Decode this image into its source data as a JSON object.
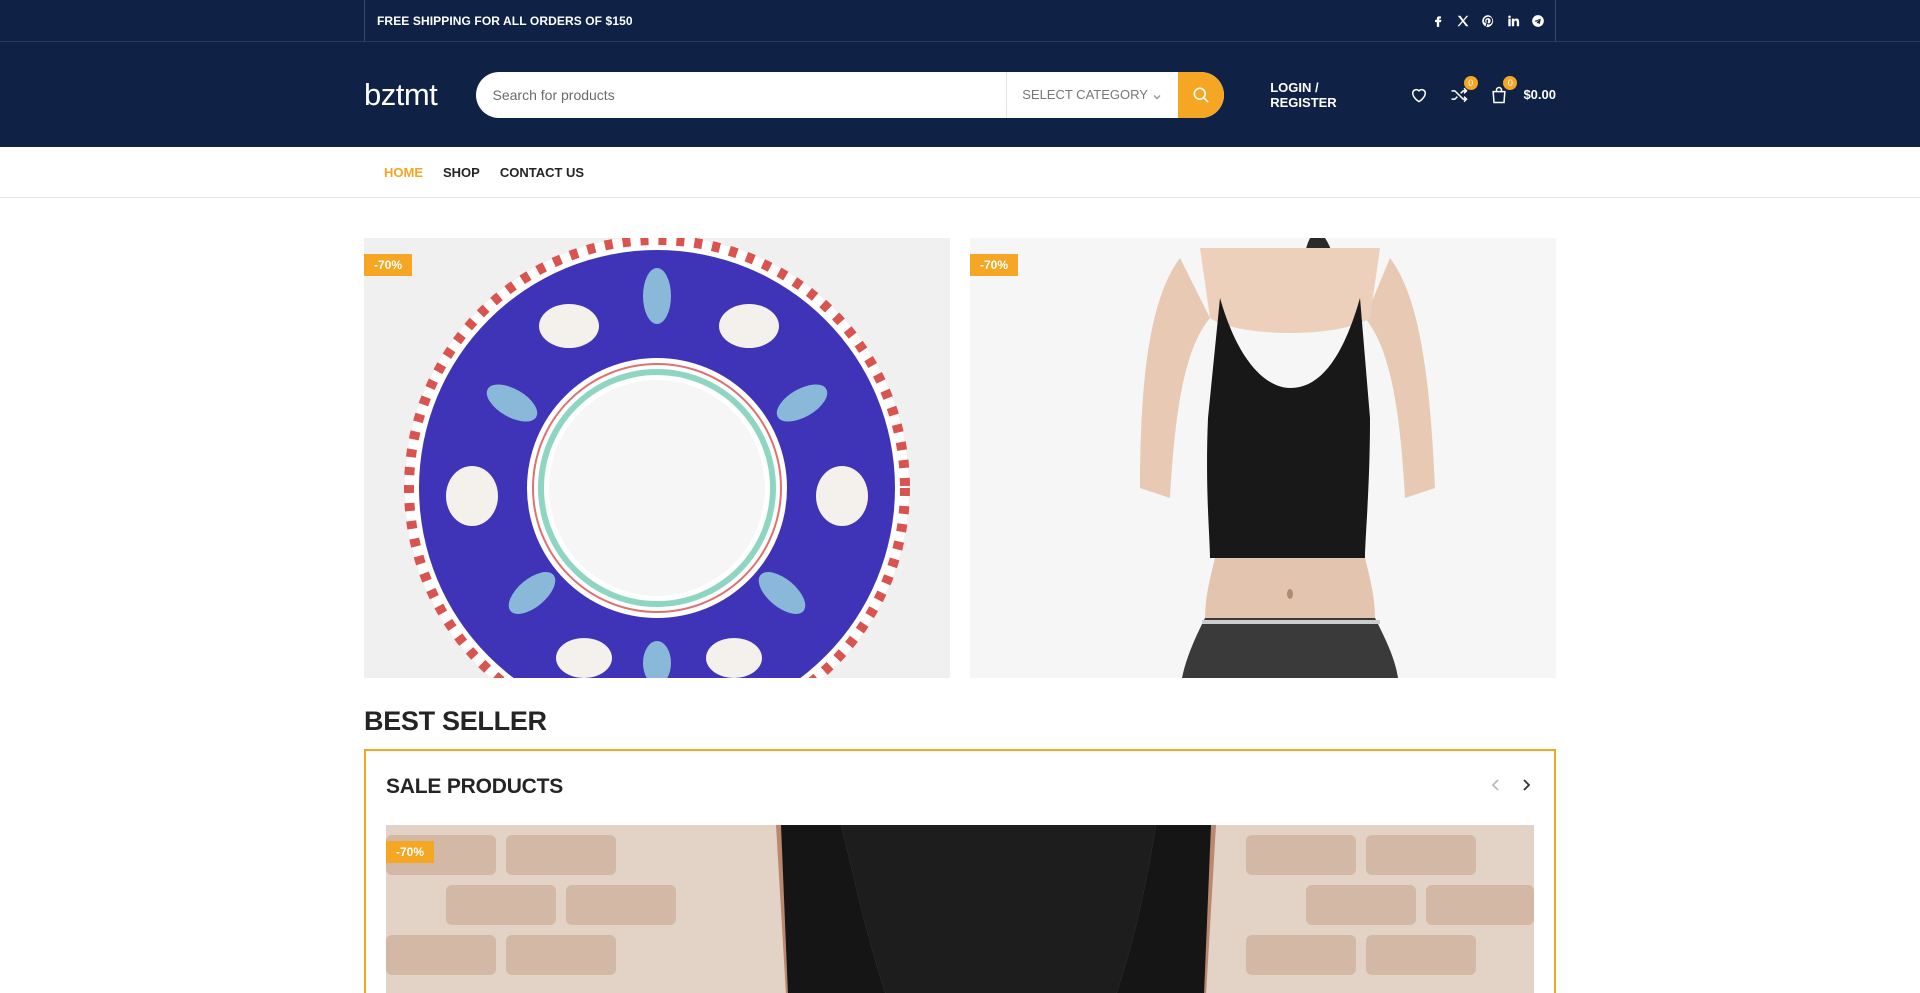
{
  "topbar": {
    "promo": "FREE SHIPPING FOR ALL ORDERS OF $150",
    "socials": [
      "facebook-icon",
      "x-icon",
      "pinterest-icon",
      "linkedin-icon",
      "telegram-icon"
    ]
  },
  "header": {
    "logo": "bztmt",
    "search_placeholder": "Search for products",
    "category": "SELECT CATEGORY",
    "login": "LOGIN / REGISTER",
    "compare_count": "0",
    "cart_count": "0",
    "cart_total": "$0.00"
  },
  "nav": {
    "items": [
      {
        "label": "HOME",
        "active": true
      },
      {
        "label": "SHOP",
        "active": false
      },
      {
        "label": "CONTACT US",
        "active": false
      }
    ]
  },
  "banners": [
    {
      "badge": "-70%",
      "subject": "plate"
    },
    {
      "badge": "-70%",
      "subject": "black-halter-top"
    }
  ],
  "best_seller": {
    "title": "BEST SELLER",
    "box_title": "SALE PRODUCTS",
    "product_badge": "-70%"
  },
  "colors": {
    "navy": "#0f2145",
    "accent": "#f5a623"
  }
}
